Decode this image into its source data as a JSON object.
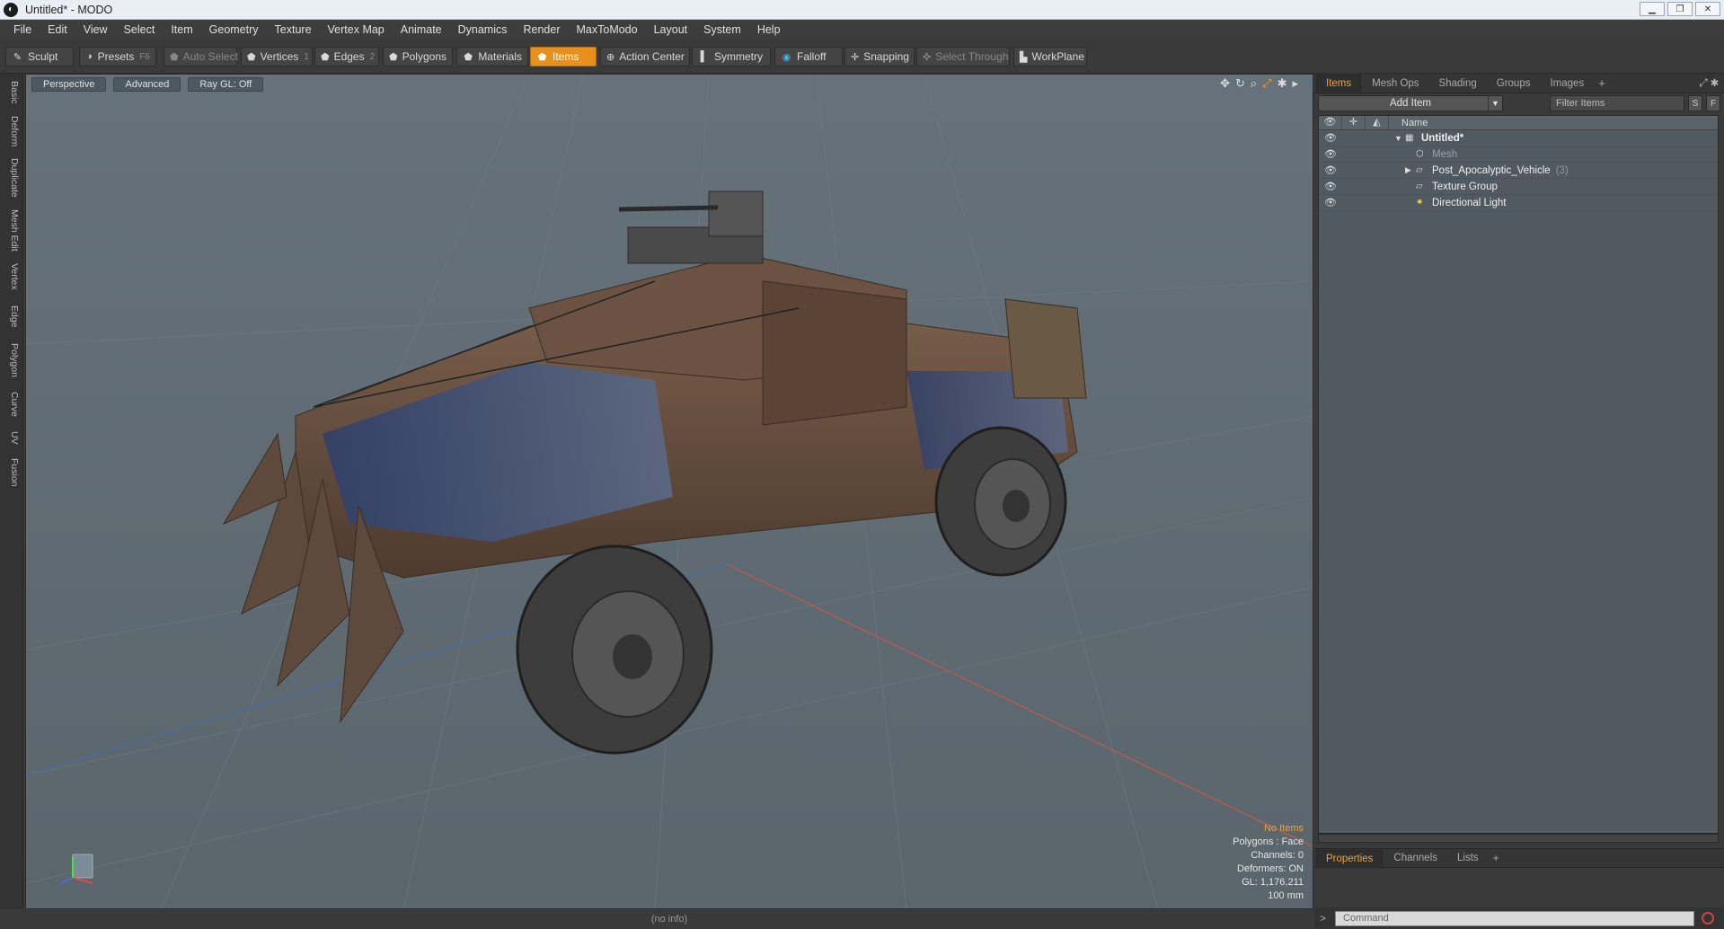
{
  "window": {
    "title": "Untitled* - MODO",
    "app_icon": "modo-logo-icon",
    "controls": [
      "minimize",
      "maximize",
      "close"
    ]
  },
  "menubar": [
    "File",
    "Edit",
    "View",
    "Select",
    "Item",
    "Geometry",
    "Texture",
    "Vertex Map",
    "Animate",
    "Dynamics",
    "Render",
    "MaxToModo",
    "Layout",
    "System",
    "Help"
  ],
  "toolbar": {
    "sculpt": "Sculpt",
    "presets": "Presets",
    "presets_key": "F6",
    "auto_select": "Auto Select",
    "vertices": "Vertices",
    "vertices_key": "1",
    "edges": "Edges",
    "edges_key": "2",
    "polygons": "Polygons",
    "materials": "Materials",
    "items": "Items",
    "action_center": "Action Center",
    "symmetry": "Symmetry",
    "falloff": "Falloff",
    "snapping": "Snapping",
    "select_through": "Select Through",
    "workplane": "WorkPlane"
  },
  "left_tabs": [
    "Basic",
    "Deform",
    "Duplicate",
    "Mesh Edit",
    "Vertex",
    "Edge",
    "Polygon",
    "Curve",
    "UV",
    "Fusion"
  ],
  "viewport": {
    "view": "Perspective",
    "shading": "Advanced",
    "raygl": "Ray GL: Off",
    "info": {
      "items": "No Items",
      "polygons": "Polygons : Face",
      "channels": "Channels: 0",
      "deformers": "Deformers: ON",
      "gl": "GL: 1,176,211",
      "scale": "100 mm"
    }
  },
  "status": "(no info)",
  "items_panel": {
    "tabs": [
      "Items",
      "Mesh Ops",
      "Shading",
      "Groups",
      "Images"
    ],
    "add_item": "Add Item",
    "filter_placeholder": "Filter Items",
    "s_button": "S",
    "f_button": "F",
    "name_header": "Name",
    "rows": [
      {
        "label": "Untitled*",
        "count": ""
      },
      {
        "label": "Mesh",
        "count": ""
      },
      {
        "label": "Post_Apocalyptic_Vehicle",
        "count": "(3)"
      },
      {
        "label": "Texture Group",
        "count": ""
      },
      {
        "label": "Directional Light",
        "count": ""
      }
    ]
  },
  "properties_panel": {
    "tabs": [
      "Properties",
      "Channels",
      "Lists"
    ]
  },
  "command": {
    "prompt": ">",
    "placeholder": "Command"
  }
}
